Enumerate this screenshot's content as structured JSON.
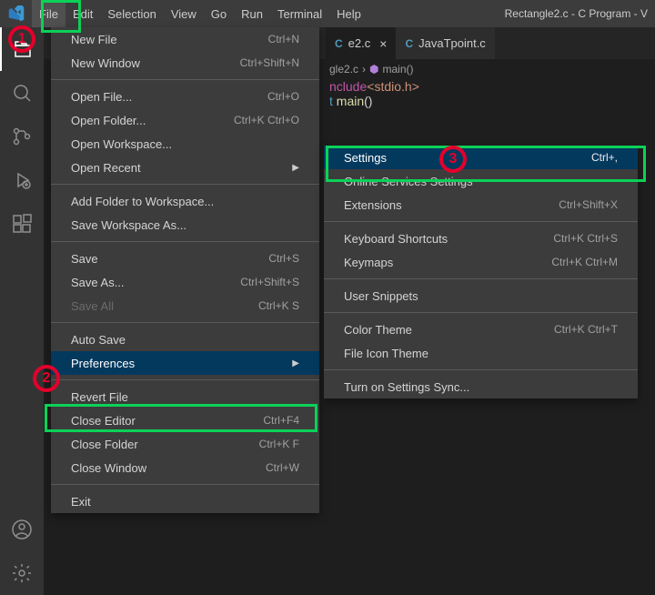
{
  "titlebar": {
    "title": "Rectangle2.c - C Program - V",
    "menus": [
      "File",
      "Edit",
      "Selection",
      "View",
      "Go",
      "Run",
      "Terminal",
      "Help"
    ]
  },
  "tabs": {
    "active": {
      "name": "e2.c",
      "iconC": "C"
    },
    "inactive": {
      "name": "JavaTpoint.c",
      "iconC": "C"
    }
  },
  "breadcrumb": {
    "file": "gle2.c",
    "symbol": "main()"
  },
  "code": {
    "include_kw": "nclude",
    "include_hdr": "<stdio.h>",
    "ret_type": "t",
    "fn_name": "main",
    "parens": "()"
  },
  "fileMenu": [
    {
      "type": "item",
      "label": "New File",
      "shortcut": "Ctrl+N"
    },
    {
      "type": "item",
      "label": "New Window",
      "shortcut": "Ctrl+Shift+N"
    },
    {
      "type": "sep"
    },
    {
      "type": "item",
      "label": "Open File...",
      "shortcut": "Ctrl+O"
    },
    {
      "type": "item",
      "label": "Open Folder...",
      "shortcut": "Ctrl+K Ctrl+O"
    },
    {
      "type": "item",
      "label": "Open Workspace..."
    },
    {
      "type": "item",
      "label": "Open Recent",
      "submenu": true
    },
    {
      "type": "sep"
    },
    {
      "type": "item",
      "label": "Add Folder to Workspace..."
    },
    {
      "type": "item",
      "label": "Save Workspace As..."
    },
    {
      "type": "sep"
    },
    {
      "type": "item",
      "label": "Save",
      "shortcut": "Ctrl+S"
    },
    {
      "type": "item",
      "label": "Save As...",
      "shortcut": "Ctrl+Shift+S"
    },
    {
      "type": "item",
      "label": "Save All",
      "shortcut": "Ctrl+K S",
      "disabled": true
    },
    {
      "type": "sep"
    },
    {
      "type": "item",
      "label": "Auto Save"
    },
    {
      "type": "item",
      "label": "Preferences",
      "submenu": true,
      "highlight": true
    },
    {
      "type": "sep"
    },
    {
      "type": "item",
      "label": "Revert File"
    },
    {
      "type": "item",
      "label": "Close Editor",
      "shortcut": "Ctrl+F4"
    },
    {
      "type": "item",
      "label": "Close Folder",
      "shortcut": "Ctrl+K F"
    },
    {
      "type": "item",
      "label": "Close Window",
      "shortcut": "Ctrl+W"
    },
    {
      "type": "sep"
    },
    {
      "type": "item",
      "label": "Exit"
    }
  ],
  "prefsMenu": [
    {
      "type": "item",
      "label": "Settings",
      "shortcut": "Ctrl+,",
      "highlight": true
    },
    {
      "type": "item",
      "label": "Online Services Settings"
    },
    {
      "type": "item",
      "label": "Extensions",
      "shortcut": "Ctrl+Shift+X"
    },
    {
      "type": "sep"
    },
    {
      "type": "item",
      "label": "Keyboard Shortcuts",
      "shortcut": "Ctrl+K Ctrl+S"
    },
    {
      "type": "item",
      "label": "Keymaps",
      "shortcut": "Ctrl+K Ctrl+M"
    },
    {
      "type": "sep"
    },
    {
      "type": "item",
      "label": "User Snippets"
    },
    {
      "type": "sep"
    },
    {
      "type": "item",
      "label": "Color Theme",
      "shortcut": "Ctrl+K Ctrl+T"
    },
    {
      "type": "item",
      "label": "File Icon Theme"
    },
    {
      "type": "sep"
    },
    {
      "type": "item",
      "label": "Turn on Settings Sync..."
    }
  ],
  "markers": {
    "1": "1",
    "2": "2",
    "3": "3"
  }
}
